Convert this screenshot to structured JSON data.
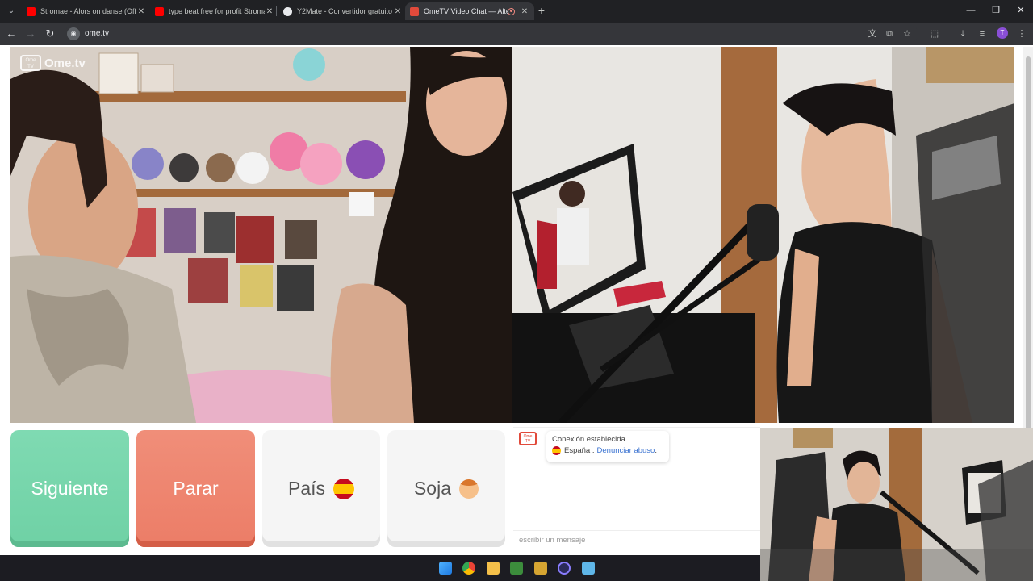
{
  "browser": {
    "tabs": [
      {
        "title": "Stromae - Alors on danse (Offic",
        "active": false
      },
      {
        "title": "type beat free for profit Stroma",
        "active": false
      },
      {
        "title": "Y2Mate - Convertidor gratuito",
        "active": false
      },
      {
        "title": "OmeTV Video Chat — Alte",
        "active": true
      }
    ],
    "url": "ome.tv",
    "profile_initial": "T"
  },
  "page": {
    "logo_box_text": "Ome TV",
    "logo_text": "Ome.tv",
    "buttons": {
      "next": "Siguiente",
      "stop": "Parar",
      "country": "País",
      "gender": "Soja"
    },
    "chat": {
      "logo_text": "Ome TV",
      "status": "Conexión establecida.",
      "country": "España",
      "report_link": "Denunciar abuso",
      "input_placeholder": "escribir un mensaje"
    }
  },
  "colors": {
    "next": "#6fd1a5",
    "stop": "#ec7d67",
    "neutral": "#f5f5f5",
    "link": "#3b73d1"
  }
}
